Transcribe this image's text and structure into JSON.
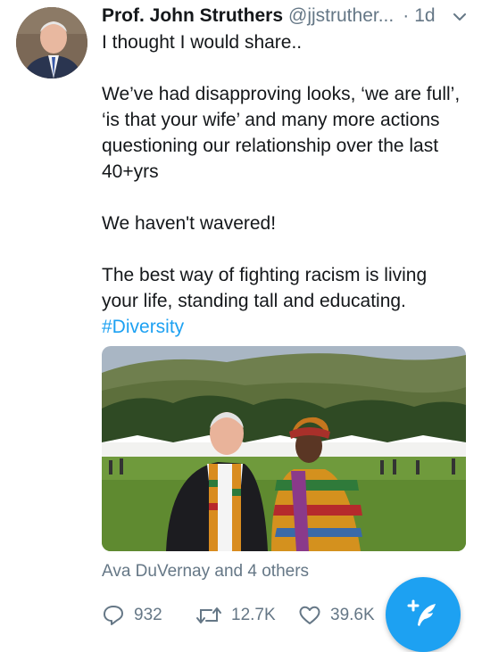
{
  "tweet": {
    "author_name": "Prof. John Struthers",
    "author_handle": "@jjstruther...",
    "separator": "·",
    "time": "1d",
    "paragraph1": "I thought I would share..",
    "paragraph2": "We’ve had disapproving looks, ‘we are full’, ‘is that your wife’ and many more actions questioning our relationship over the last 40+yrs",
    "paragraph3": "We haven't wavered!",
    "paragraph4": "The best way of fighting racism is living your life, standing tall and educating.",
    "hashtag": "#Diversity",
    "social_context": "Ava DuVernay and 4 others"
  },
  "actions": {
    "replies": "932",
    "retweets": "12.7K",
    "likes": "39.6K"
  },
  "icons": {
    "avatar": "avatar",
    "caret": "chevron-down-icon",
    "reply": "reply-icon",
    "retweet": "retweet-icon",
    "like": "heart-icon",
    "compose": "compose-tweet-icon"
  },
  "colors": {
    "text": "#14171a",
    "secondary": "#657786",
    "link": "#1da1f2",
    "fab": "#1da1f2"
  }
}
